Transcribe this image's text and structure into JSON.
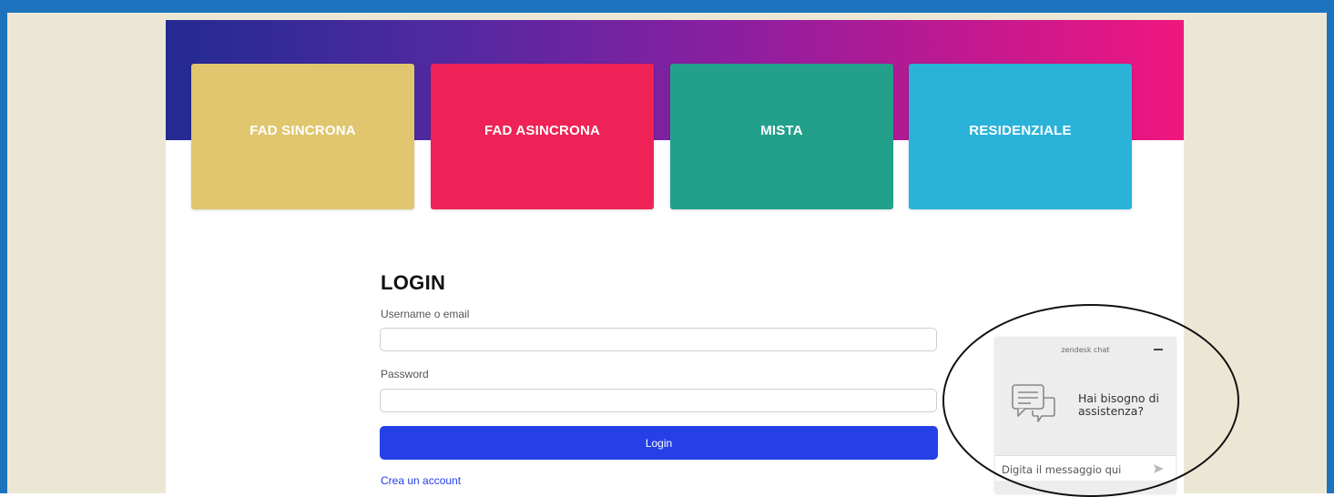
{
  "cards": [
    {
      "label": "FAD SINCRONA",
      "color": "#e0c66f"
    },
    {
      "label": "FAD ASINCRONA",
      "color": "#ee2256"
    },
    {
      "label": "MISTA",
      "color": "#23a08b"
    },
    {
      "label": "RESIDENZIALE",
      "color": "#29b3d8"
    }
  ],
  "login": {
    "title": "LOGIN",
    "username_label": "Username o email",
    "username_value": "",
    "password_label": "Password",
    "password_value": "",
    "button_label": "Login",
    "create_account": "Crea un account"
  },
  "chat": {
    "header": "zendesk chat",
    "message": "Hai bisogno di assistenza?",
    "input_placeholder": "Digita il messaggio qui",
    "icons": [
      "chat-bubbles-icon",
      "send-icon",
      "minimize-icon"
    ]
  },
  "colors": {
    "primary": "#2440e6",
    "frame": "#1e73be",
    "background": "#ece7d5"
  }
}
